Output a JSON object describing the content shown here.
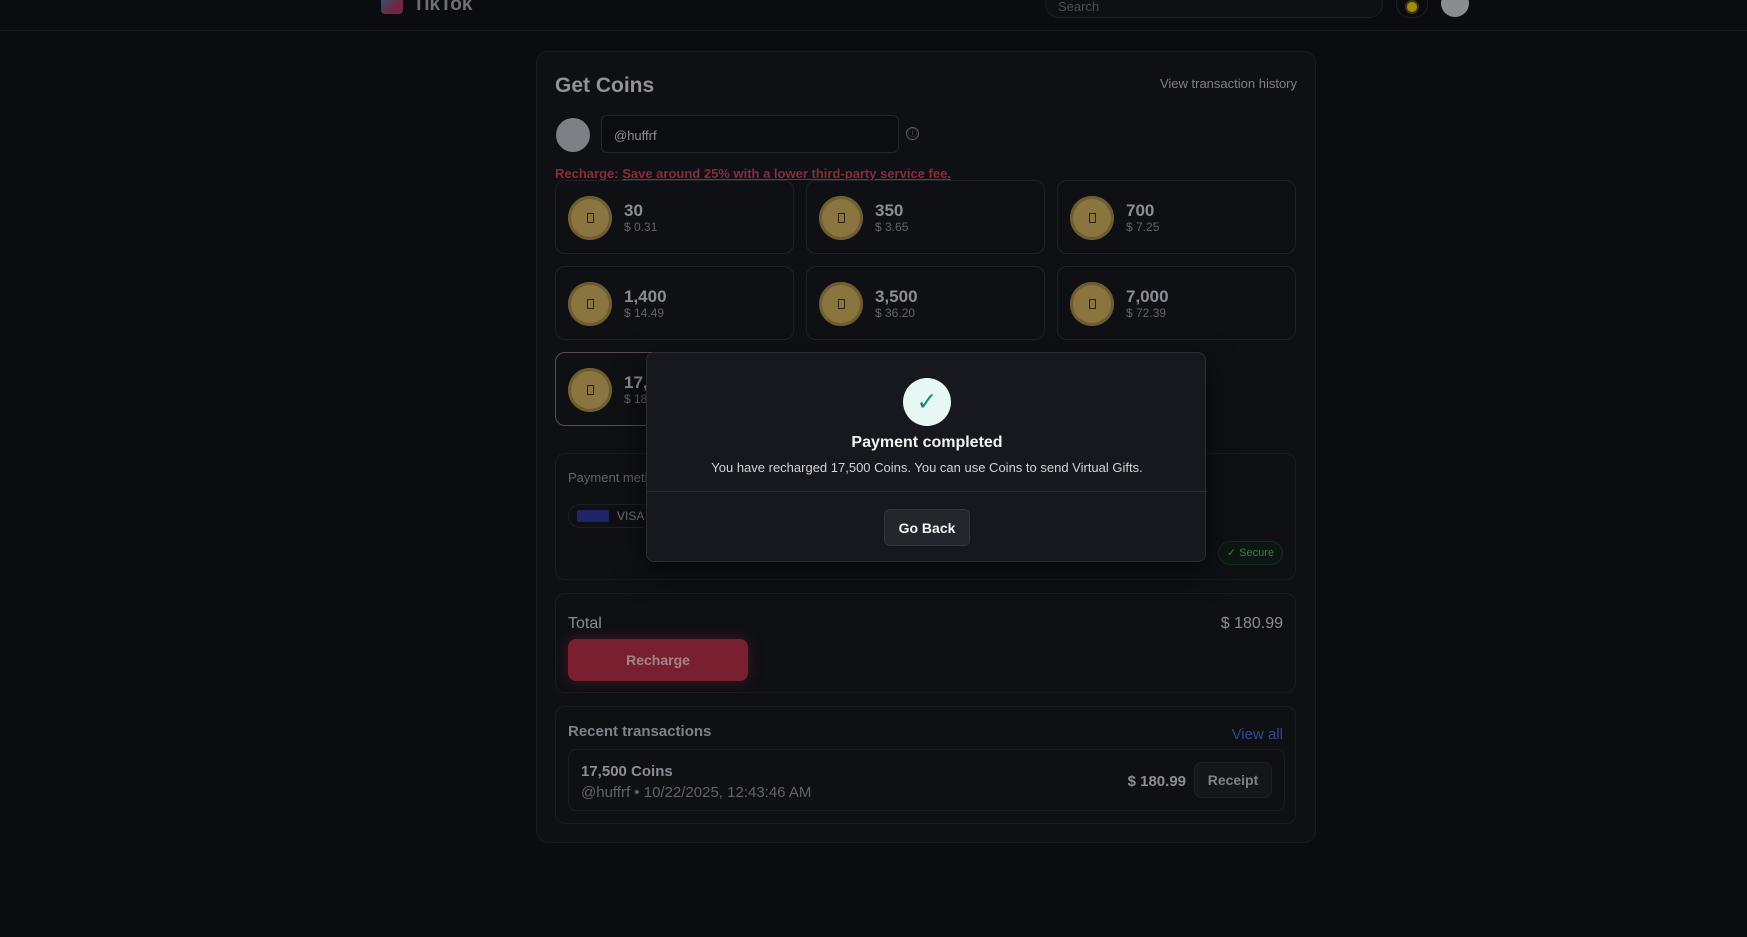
{
  "header": {
    "app_name": "TikTok",
    "search_placeholder": "Search"
  },
  "coins_page": {
    "title": "Get Coins",
    "history_link": "View transaction history",
    "account_username": "@huffrf",
    "info_icon": "ⓘ",
    "recharge_label": "Recharge:",
    "recharge_promo": "Save around 25% with a lower third-party service fee.",
    "packages": [
      {
        "amount": "30",
        "price": "$ 0.31"
      },
      {
        "amount": "350",
        "price": "$ 3.65"
      },
      {
        "amount": "700",
        "price": "$ 7.25"
      },
      {
        "amount": "1,400",
        "price": "$ 14.49"
      },
      {
        "amount": "3,500",
        "price": "$ 36.20"
      },
      {
        "amount": "7,000",
        "price": "$ 72.39"
      },
      {
        "amount": "17,",
        "price": "$ 18"
      }
    ],
    "payment_label": "Payment meth",
    "payment_method": "VISA",
    "secure_badge": "✓ Secure",
    "total_label": "Total",
    "total_value": "$ 180.99",
    "recharge_button": "Recharge"
  },
  "recent": {
    "title": "Recent transactions",
    "view_all": "View all",
    "transactions": [
      {
        "title": "17,500 Coins",
        "meta": "@huffrf • 10/22/2025, 12:43:46 AM",
        "amount": "$ 180.99",
        "receipt_label": "Receipt"
      }
    ]
  },
  "modal": {
    "check_glyph": "✓",
    "title": "Payment completed",
    "message": "You have recharged 17,500 Coins. You can use Coins to send Virtual Gifts.",
    "button": "Go Back"
  },
  "colors": {
    "background": "#0b0c10",
    "accent": "#7a1f30",
    "modal_bg": "#16181d",
    "success": "#1f8a78"
  },
  "icons": [
    "tiktok-logo-icon",
    "sun-icon",
    "info-icon",
    "coin-icon",
    "visa-card-icon",
    "check-icon"
  ]
}
